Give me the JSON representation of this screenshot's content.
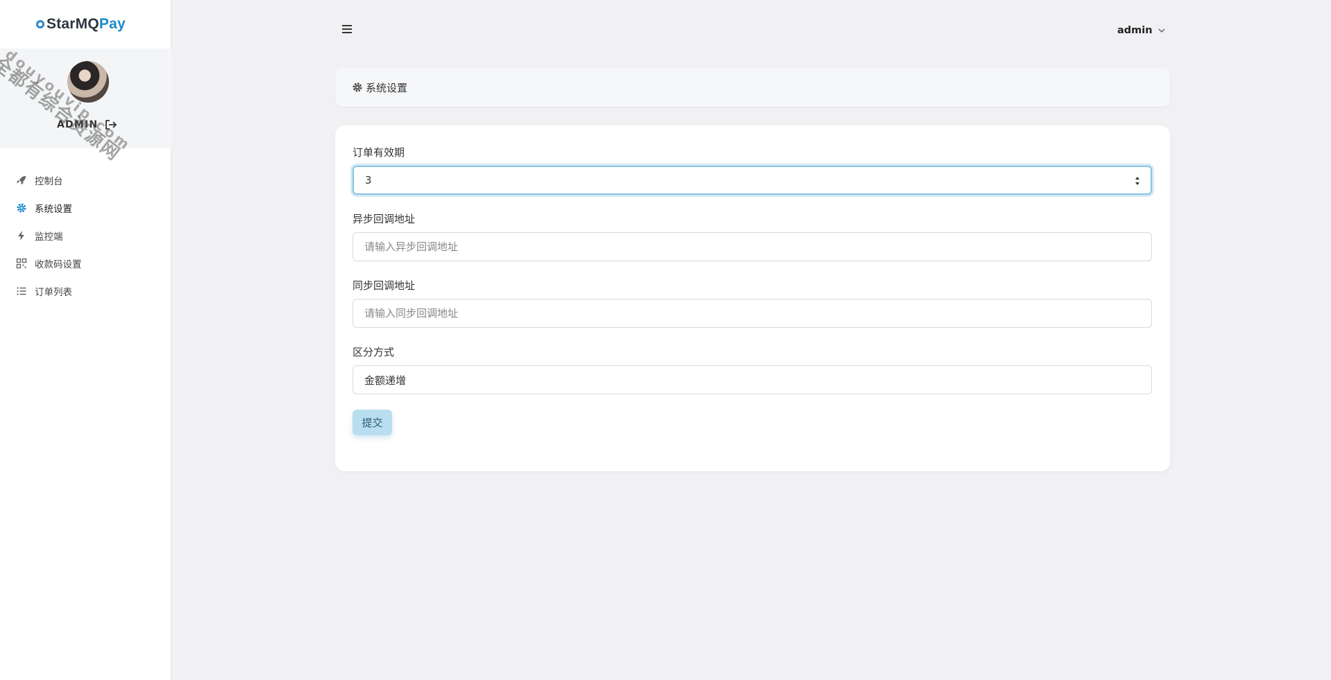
{
  "brand": {
    "part1": "StarMQ",
    "part2": "Pay"
  },
  "profile": {
    "name": "ADMIN"
  },
  "watermark": {
    "line1": "全都有综合资源网",
    "line2": "douyouvip.com"
  },
  "sidebar": {
    "items": [
      {
        "label": "控制台",
        "icon": "rocket-icon"
      },
      {
        "label": "系统设置",
        "icon": "gear-icon",
        "active": true
      },
      {
        "label": "监控端",
        "icon": "bolt-icon"
      },
      {
        "label": "收款码设置",
        "icon": "qrcode-icon"
      },
      {
        "label": "订单列表",
        "icon": "list-icon"
      }
    ]
  },
  "header": {
    "user": "admin"
  },
  "breadcrumb": {
    "title": "系统设置"
  },
  "form": {
    "expire": {
      "label": "订单有效期",
      "value": "3"
    },
    "notify_url": {
      "label": "异步回调地址",
      "placeholder": "请输入异步回调地址",
      "value": ""
    },
    "return_url": {
      "label": "同步回调地址",
      "placeholder": "请输入同步回调地址",
      "value": ""
    },
    "mode": {
      "label": "区分方式",
      "value": "金额递增"
    },
    "submit_label": "提交"
  },
  "colors": {
    "accent": "#1b8ac9",
    "focus": "#8ac2e3",
    "button_bg": "#b9deef"
  }
}
